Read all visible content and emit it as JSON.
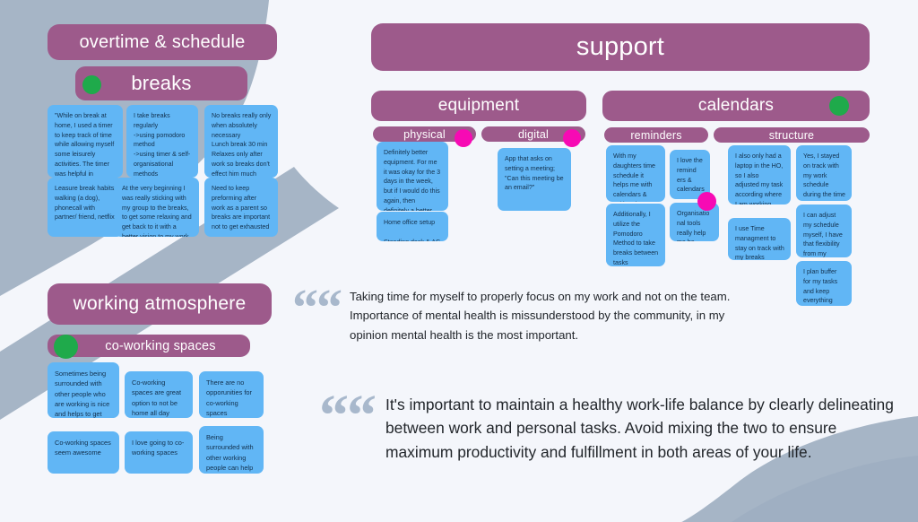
{
  "colors": {
    "background": "#f4f6fb",
    "header_purple": "#9d5a8b",
    "note_blue": "#61b6f5",
    "dot_green": "#1faa4b",
    "dot_magenta": "#f70ab4",
    "decor_grey": "#a6b5c6",
    "quote_mark": "#a8b8cc"
  },
  "sections": {
    "overtime": {
      "title": "overtime & schedule",
      "subsection": {
        "title": "breaks",
        "dot": "green",
        "notes": [
          "\"While on break at home, I used a timer to keep track of time while allowing myself some leisurely activities. The timer was helpful in ensuring that I didn't lose track of time.\"",
          "I take breaks regularly\n->using pomodoro method\n->using timer & self-organisational methods",
          "No breaks really only when absolutely necessary\nLunch break 30 min\nRelaxes only after work so breaks don't effect him much",
          "Leasure break habits; walking (a dog), phonecall with partner/ friend, netflix",
          "At the very beginning I was really sticking with my group to the breaks, to get some relaxing and get back to it with a better vision  to my work.",
          "Need to keep preforming after work as a parent so breaks are important not to get exhausted"
        ]
      }
    },
    "support": {
      "title": "support",
      "equipment": {
        "title": "equipment",
        "tabs": [
          {
            "label": "physical",
            "dot": "magenta"
          },
          {
            "label": "digital",
            "dot": "magenta"
          }
        ],
        "physical_notes": [
          "Definitely better equipment. For me it was okay for the 3 days in the week, but if I would do this again, then definitely a better mouse, keyboard and another desktop.",
          "Home office setup\n\nStanding desk & AC"
        ],
        "digital_notes": [
          "App that asks on setting a meeting;\n\"Can this meeting be an email?\""
        ]
      },
      "calendars": {
        "title": "calendars",
        "dot": "green",
        "tabs": [
          {
            "label": "reminders"
          },
          {
            "label": "structure"
          }
        ],
        "reminders_notes": [
          "With my daughters time schedule  it helps me with calendars & writing the deadline down.",
          "I love the remind ers & calendars",
          "Additionally, I utilize the Pomodoro Method to take breaks between tasks throughout the day.",
          "Organisatio nal tools really help me be organized"
        ],
        "structure_notes": [
          "I also only had a laptop in the HO, so I also adjusted my task according where I am working during the week.",
          "Yes, I stayed on track with my work schedule during the time I worked in the HO.",
          "I use Time managment to stay on track with my breaks",
          " I can adjust my schedule myself, I have that flexibility from my employer.",
          "I plan buffer for my tasks and keep everything organised"
        ]
      }
    },
    "atmosphere": {
      "title": "working atmosphere",
      "subsection": {
        "title": "co-working spaces",
        "dot": "green",
        "notes": [
          "Sometimes being surrounded with other people who are working is nice and helps to get into the working atmosphere",
          "Co-working spaces are great option to not be home all day",
          "There are no opporunities for co-working spaces",
          "Co-working spaces seem awesome",
          "I love going to co-working spaces",
          "Being surrounded with other working people can help with geting in that mood"
        ]
      }
    }
  },
  "quotes": [
    {
      "mark": "““",
      "text": "Taking time for myself to properly focus on my work and not on the team. Importance of mental health is missunderstood by the community, in my opinion mental health is the most important."
    },
    {
      "mark": "““",
      "text": "It's important to maintain a healthy work-life balance by clearly delineating between work and personal tasks. Avoid mixing the two to ensure maximum productivity and fulfillment in both areas of your life."
    }
  ]
}
